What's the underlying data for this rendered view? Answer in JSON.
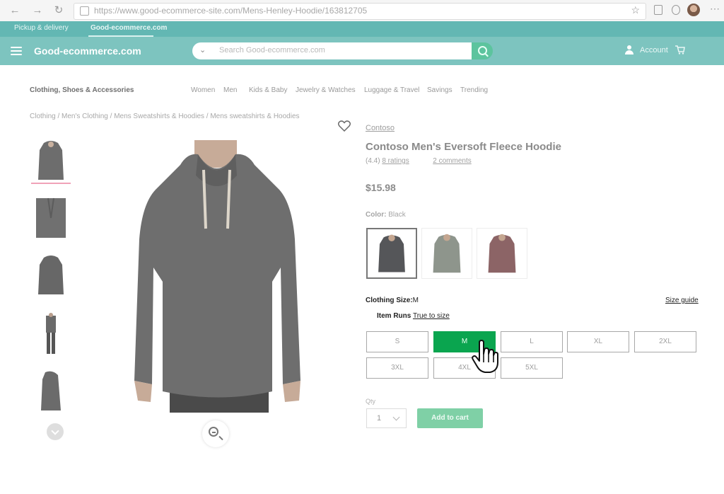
{
  "browser": {
    "url": "https://www.good-ecommerce-site.com/Mens-Henley-Hoodie/163812705"
  },
  "topbar": {
    "tabs": [
      "Pickup & delivery",
      "Good-ecommerce.com"
    ]
  },
  "header": {
    "logo": "Good-ecommerce.com",
    "search_placeholder": "Search Good-ecommerce.com",
    "account_label": "Account"
  },
  "category_nav": {
    "title": "Clothing, Shoes & Accessories",
    "links": [
      "Women",
      "Men",
      "Kids & Baby",
      "Jewelry & Watches",
      "Luggage & Travel",
      "Savings",
      "Trending"
    ]
  },
  "breadcrumb": "Clothing / Men's Clothing / Mens Sweatshirts & Hoodies / Mens sweatshirts & Hoodies",
  "product": {
    "brand": "Contoso",
    "title": "Contoso Men's Eversoft Fleece Hoodie",
    "rating_prefix": "(4.4)",
    "ratings_link": "8 ratings",
    "comments_link": "2 comments",
    "price": "$15.98",
    "color_label": "Color:",
    "color_value": "Black",
    "swatches": [
      {
        "name": "Black",
        "hex": "#555659"
      },
      {
        "name": "Gray",
        "hex": "#8e958c"
      },
      {
        "name": "Burgundy",
        "hex": "#8c6466"
      }
    ],
    "size_label": "Clothing Size:",
    "size_value": "M",
    "size_guide": "Size guide",
    "item_runs_label": "Item Runs",
    "item_runs_value": "True to size",
    "sizes": [
      "S",
      "M",
      "L",
      "XL",
      "2XL",
      "3XL",
      "4XL",
      "5XL"
    ],
    "selected_size": "M",
    "qty_label": "Qty",
    "qty_value": "1",
    "add_to_cart": "Add to cart"
  },
  "colors": {
    "teal_header": "#7dc4bf",
    "teal_topbar": "#63b7b3",
    "selected_size": "#0aa54f",
    "add_to_cart": "#7fd0a6"
  }
}
